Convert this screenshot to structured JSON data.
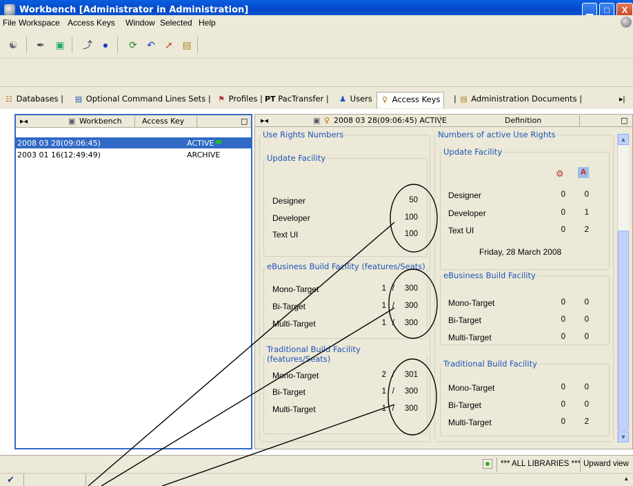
{
  "window": {
    "title": "Workbench [Administrator in Administration]",
    "min": "▁",
    "max": "□",
    "close": "X"
  },
  "menu": [
    "File",
    "Workspace",
    "Access Keys",
    "Window",
    "Selected",
    "Help"
  ],
  "toolbar_icons": [
    "users-icon",
    "edit-icon",
    "database-icon",
    "arrow-icon",
    "globe-icon",
    "refresh-icon",
    "undo-icon",
    "redo-icon",
    "document-icon"
  ],
  "tabs": [
    {
      "label": "Databases",
      "icon": "☷"
    },
    {
      "label": "Optional Command Lines Sets",
      "icon": "▤"
    },
    {
      "label": "Profiles",
      "icon": "⚑"
    },
    {
      "label": "PacTransfer",
      "icon": "PT"
    },
    {
      "label": "Users",
      "icon": "♟"
    },
    {
      "label": "Access Keys",
      "icon": "♀"
    },
    {
      "label": "Administration Documents",
      "icon": "▤"
    }
  ],
  "tab_scroll": "▸|",
  "left_panel": {
    "header_left": "▸◂",
    "header_workbench": "Workbench",
    "header_access_key": "Access Key",
    "header_max": "□",
    "rows": [
      {
        "key": "2008 03 28(09:06:45)",
        "status": "ACTIVE"
      },
      {
        "key": "2003 01 16(12:49:49)",
        "status": "ARCHIVE"
      }
    ]
  },
  "right_panel": {
    "header_left": "▸◂",
    "header_title": "2008 03 28(09:06:45) ACTIVE",
    "header_definition": "Definition",
    "header_max": "□",
    "use_rights": {
      "legend": "Use Rights Numbers",
      "update": {
        "legend": "Update Facility",
        "rows": [
          {
            "label": "Designer",
            "value": "50"
          },
          {
            "label": "Developer",
            "value": "100"
          },
          {
            "label": "Text UI",
            "value": "100"
          }
        ]
      },
      "ebusiness": {
        "legend": "eBusiness Build Facility (features/Seats)",
        "rows": [
          {
            "label": "Mono-Target",
            "features": "1",
            "slash": "/",
            "seats": "300"
          },
          {
            "label": "Bi-Target",
            "features": "1",
            "slash": "/",
            "seats": "300"
          },
          {
            "label": "Multi-Target",
            "features": "1",
            "slash": "/",
            "seats": "300"
          }
        ]
      },
      "traditional": {
        "legend": "Traditional Build Facility (features/Seats)",
        "rows": [
          {
            "label": "Mono-Target",
            "features": "2",
            "slash": "/",
            "seats": "301"
          },
          {
            "label": "Bi-Target",
            "features": "1",
            "slash": "/",
            "seats": "300"
          },
          {
            "label": "Multi-Target",
            "features": "1",
            "slash": "/",
            "seats": "300"
          }
        ]
      }
    },
    "active_rights": {
      "legend": "Numbers of active Use Rights",
      "update": {
        "legend": "Update Facility",
        "rows": [
          {
            "label": "Designer",
            "a": "0",
            "b": "0"
          },
          {
            "label": "Developer",
            "a": "0",
            "b": "1"
          },
          {
            "label": "Text UI",
            "a": "0",
            "b": "2"
          }
        ],
        "date": "Friday, 28 March 2008"
      },
      "ebusiness": {
        "legend": "eBusiness Build Facility",
        "rows": [
          {
            "label": "Mono-Target",
            "a": "0",
            "b": "0"
          },
          {
            "label": "Bi-Target",
            "a": "0",
            "b": "0"
          },
          {
            "label": "Multi-Target",
            "a": "0",
            "b": "0"
          }
        ]
      },
      "traditional": {
        "legend": "Traditional Build Facility",
        "rows": [
          {
            "label": "Mono-Target",
            "a": "0",
            "b": "0"
          },
          {
            "label": "Bi-Target",
            "a": "0",
            "b": "0"
          },
          {
            "label": "Multi-Target",
            "a": "0",
            "b": "2"
          }
        ]
      }
    },
    "scroll_up": "▲",
    "scroll_down": "▼"
  },
  "status": {
    "libraries": "*** ALL LIBRARIES ***",
    "view": "Upward view",
    "check": "✔",
    "arrow": "▴"
  },
  "colors": {
    "selection": "#316ac5",
    "legend": "#1c53b9",
    "active_dot": "#21c21f",
    "titlebar": "#0349c7"
  }
}
